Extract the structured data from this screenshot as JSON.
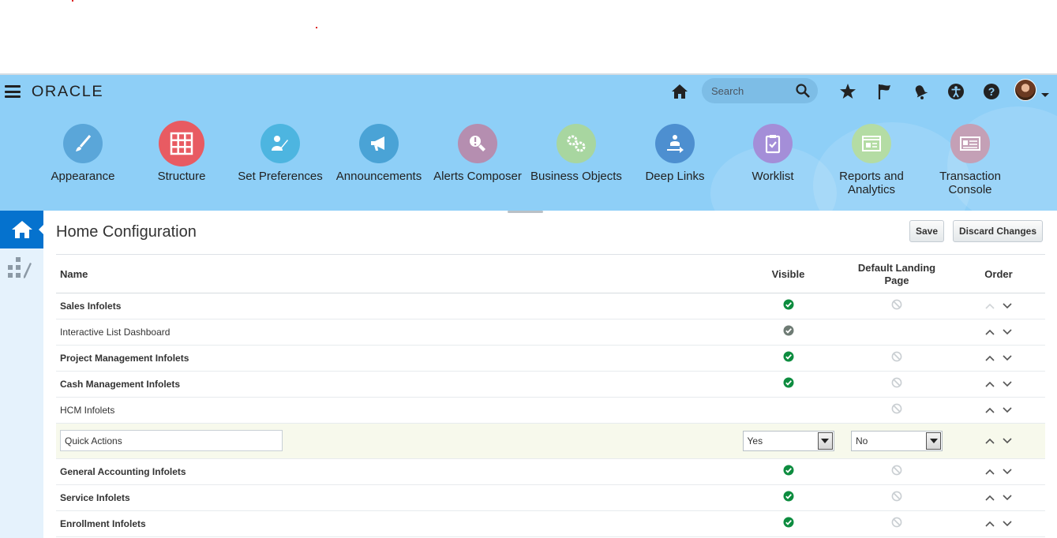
{
  "app": {
    "logo": "ORACLE",
    "search_placeholder": "Search"
  },
  "toolbar": [
    {
      "label": "Appearance",
      "icon": "brush-icon",
      "color": "#5aa6d9"
    },
    {
      "label": "Structure",
      "icon": "grid-icon",
      "color": "#e85b62"
    },
    {
      "label": "Set Preferences",
      "icon": "person-edit-icon",
      "color": "#4db5e0"
    },
    {
      "label": "Announcements",
      "icon": "megaphone-icon",
      "color": "#4aa3d6"
    },
    {
      "label": "Alerts Composer",
      "icon": "alert-wrench-icon",
      "color": "#b58eb0"
    },
    {
      "label": "Business Objects",
      "icon": "gears-icon",
      "color": "#a8d6a0"
    },
    {
      "label": "Deep Links",
      "icon": "link-arrow-icon",
      "color": "#4d8fd0"
    },
    {
      "label": "Worklist",
      "icon": "clipboard-check-icon",
      "color": "#a48ed8"
    },
    {
      "label": "Reports and Analytics",
      "icon": "report-icon",
      "color": "#b4dca4"
    },
    {
      "label": "Transaction Console",
      "icon": "console-icon",
      "color": "#c4a0b6"
    }
  ],
  "page": {
    "title": "Home Configuration",
    "save_label": "Save",
    "discard_label": "Discard Changes"
  },
  "table": {
    "columns": [
      "Name",
      "Visible",
      "Default Landing Page",
      "Order"
    ],
    "rows": [
      {
        "name": "Sales Infolets",
        "bold": true,
        "visible": "check",
        "landing": "disabled",
        "up_enabled": false
      },
      {
        "name": "Interactive List Dashboard",
        "bold": false,
        "visible": "check-grey",
        "landing": "",
        "up_enabled": true
      },
      {
        "name": "Project Management Infolets",
        "bold": true,
        "visible": "check",
        "landing": "disabled",
        "up_enabled": true
      },
      {
        "name": "Cash Management Infolets",
        "bold": true,
        "visible": "check",
        "landing": "disabled",
        "up_enabled": true
      },
      {
        "name": "HCM Infolets",
        "bold": false,
        "visible": "",
        "landing": "disabled",
        "up_enabled": true
      },
      {
        "name": "Quick Actions",
        "bold": false,
        "editing": true,
        "visible_value": "Yes",
        "landing_value": "No",
        "up_enabled": true
      },
      {
        "name": "General Accounting Infolets",
        "bold": true,
        "visible": "check",
        "landing": "disabled",
        "up_enabled": true
      },
      {
        "name": "Service Infolets",
        "bold": true,
        "visible": "check",
        "landing": "disabled",
        "up_enabled": true
      },
      {
        "name": "Enrollment Infolets",
        "bold": true,
        "visible": "check",
        "landing": "disabled",
        "up_enabled": true
      }
    ]
  },
  "colors": {
    "header_bg": "#8ecff7",
    "accent": "#0572ce",
    "check_green": "#0d8c3f"
  }
}
